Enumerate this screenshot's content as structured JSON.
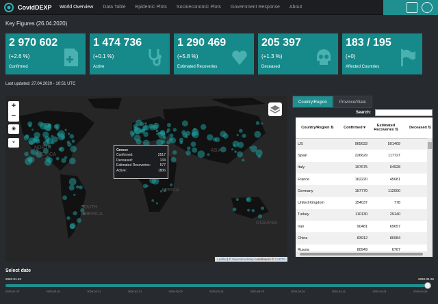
{
  "nav": {
    "brand": "CovidDEXP",
    "links": [
      "World Overview",
      "Data Table",
      "Epidemic Plots",
      "Socioeconomic Plots",
      "Government Response",
      "About"
    ]
  },
  "key_figures_title": "Key Figures (26.04.2020)",
  "kpis": [
    {
      "value": "2 970 602",
      "change": "(+2.6 %)",
      "label": "Confirmed",
      "icon": "document-plus-icon"
    },
    {
      "value": "1 474 736",
      "change": "(+0.1 %)",
      "label": "Active",
      "icon": "stethoscope-icon"
    },
    {
      "value": "1 290 469",
      "change": "(+5.8 %)",
      "label": "Estimated Recoveries",
      "icon": "heart-icon"
    },
    {
      "value": "205 397",
      "change": "(+1.3 %)",
      "label": "Deceased",
      "icon": "skull-icon"
    },
    {
      "value": "183 / 195",
      "change": "(+0)",
      "label": "Affected Countries",
      "icon": "flag-icon"
    }
  ],
  "last_updated": "Last updated: 27.04.2020 - 10:51 UTC",
  "map": {
    "zoom_in": "+",
    "zoom_out": "−",
    "labels": [
      "NORTH",
      "AMERICA",
      "SOUTH",
      "AMERICA",
      "AFRICA",
      "ASIA",
      "OCEANIA"
    ],
    "tooltip": {
      "country": "Greece",
      "rows": [
        {
          "label": "Confirmed:",
          "value": "2517"
        },
        {
          "label": "Deceased:",
          "value": "134"
        },
        {
          "label": "Estimated Recoveries:",
          "value": "577"
        },
        {
          "label": "Active:",
          "value": "1806"
        }
      ]
    },
    "attribution": {
      "leaflet": "Leaflet",
      "sep1": " | © ",
      "osm": "OpenStreetMap",
      "mid": " contributors © ",
      "carto": "CARTO"
    },
    "accent_color": "#1f9a9a"
  },
  "tabs": [
    "Country/Region",
    "Province/State"
  ],
  "search_label": "Search:",
  "table": {
    "headers": [
      "Country/Region",
      "Confirmed",
      "Estimated Recoveries",
      "Deceased"
    ],
    "rows": [
      [
        "US",
        "965633",
        "501409",
        "5375"
      ],
      [
        "Spain",
        "226629",
        "117727",
        "2319"
      ],
      [
        "Italy",
        "197675",
        "64928",
        "2664"
      ],
      [
        "France",
        "162220",
        "45681",
        "2289"
      ],
      [
        "Germany",
        "157770",
        "112000",
        "597"
      ],
      [
        "United Kingdom",
        "154037",
        "778",
        "2079"
      ],
      [
        "Turkey",
        "110130",
        "29140",
        "280"
      ],
      [
        "Iran",
        "90481",
        "69657",
        "571"
      ],
      [
        "China",
        "83912",
        "80984",
        "463"
      ],
      [
        "Russia",
        "80949",
        "6767",
        "74"
      ]
    ]
  },
  "slider": {
    "title": "Select date",
    "min": "2020-01-22",
    "max": "2020-04-26",
    "position_fraction": 1.0,
    "ticks": [
      "2020-01-22",
      "2020-02-01",
      "2020-02-11",
      "2020-02-21",
      "2020-03-02",
      "2020-03-12",
      "2020-03-22",
      "2020-04-01",
      "2020-04-11",
      "2020-04-21",
      "2020-04-26"
    ]
  }
}
